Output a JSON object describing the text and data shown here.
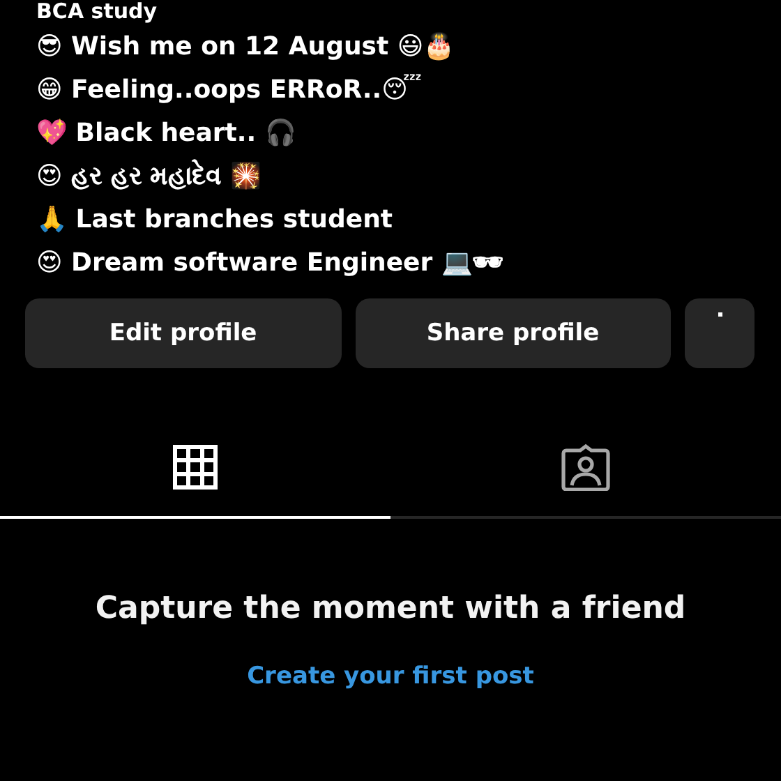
{
  "bio": [
    "BCA study",
    "😎 Wish me on 12 August 😃🎂",
    "😁 Feeling..oops ERRoR..😴",
    "💖 Black heart.. 🎧",
    "😍 હર હર મહાદેવ 🎇",
    "🙏 Last branches student",
    "😍 Dream software Engineer 💻🕶"
  ],
  "buttons": [
    {
      "label": "Edit profile",
      "kind": "text"
    },
    {
      "label": "Share profile",
      "kind": "text"
    },
    {
      "kind": "icon"
    }
  ],
  "tabs": [
    {
      "kind": "grid",
      "selected": true
    },
    {
      "kind": "tagged",
      "selected": false
    }
  ],
  "empty_state": {
    "title": "Capture the moment with a friend",
    "link": "Create your first post"
  }
}
